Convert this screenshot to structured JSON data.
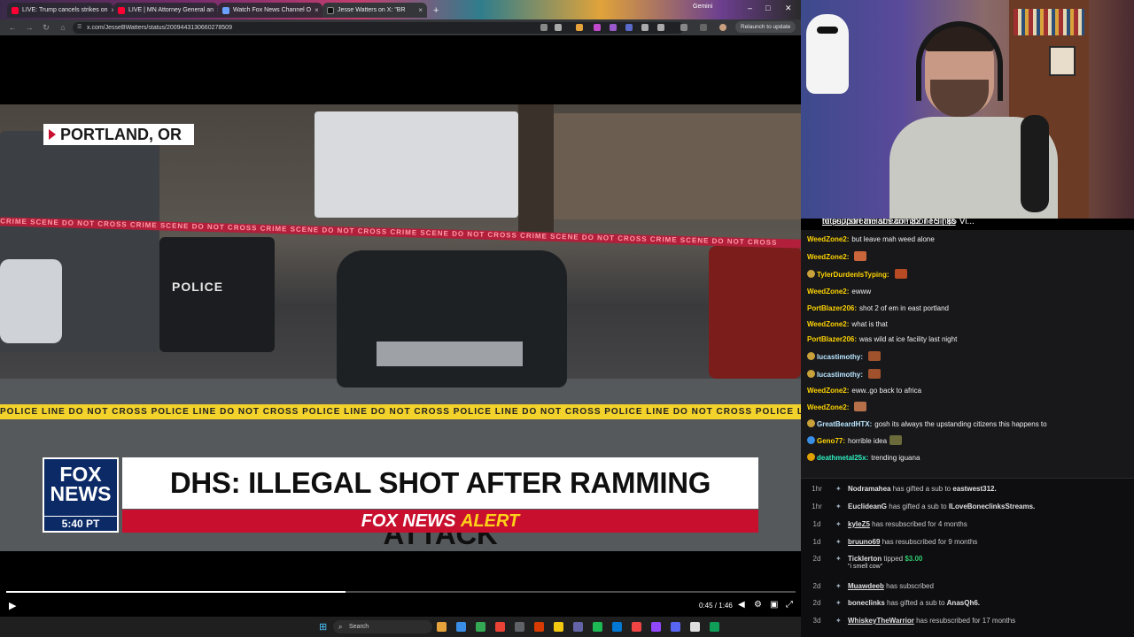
{
  "browser": {
    "tabs": [
      {
        "label": "LIVE: Trump cancels strikes on",
        "color": "#ff0033"
      },
      {
        "label": "LIVE | MN Attorney General an",
        "color": "#ff0033"
      },
      {
        "label": "Watch Fox News Channel O",
        "color": "#6aa0ff"
      },
      {
        "label": "Jesse Watters on X: \"BR",
        "color": "#111111"
      }
    ],
    "new_tab": "+",
    "profile_label": "Gemini",
    "url": "x.com/JesseBWatters/status/2009443130660278509",
    "relaunch_label": "Relaunch to update",
    "window_controls": [
      "–",
      "□",
      "✕"
    ]
  },
  "video": {
    "location": "PORTLAND, OR",
    "police_text": "POLICE",
    "crime_tape_text": "CRIME SCENE DO NOT CROSS   CRIME SCENE DO NOT CROSS   CRIME SCENE DO NOT CROSS   CRIME SCENE DO NOT CROSS   CRIME SCENE DO NOT CROSS   CRIME SCENE DO NOT CROSS",
    "police_tape_text": "POLICE LINE DO NOT CROSS   POLICE LINE DO NOT CROSS   POLICE LINE DO NOT CROSS   POLICE LINE DO NOT CROSS   POLICE LINE DO NOT CROSS   POLICE LINE DO NOT CROSS",
    "network_logo": "FOX NEWS",
    "timestamp": "5:40 PT",
    "headline": "DHS: ILLEGAL SHOT AFTER RAMMING ATTACK",
    "alert_prefix": "FOX NEWS",
    "alert_word": "ALERT",
    "progress": 0.43,
    "time_display": "0:45 / 1:46",
    "play_icon": "▶"
  },
  "taskbar": {
    "search_label": "Search",
    "icons": [
      "#e7a33b",
      "#3a8ee6",
      "#34a853",
      "#ea4335",
      "#5f6368",
      "#d83b01",
      "#f2c811",
      "#6264a7",
      "#1db954",
      "#0078d4",
      "#e44",
      "#9146ff",
      "#5865f2",
      "#ddd",
      "#0f9d58"
    ]
  },
  "chat": {
    "ticker_link": "https://streamlabs.com/boneclinks",
    "ticker_text": " to support the stream! $2 TTS | $5 Vi...",
    "messages": [
      {
        "user": "WeedZone2:",
        "color": "#ffd400",
        "text": "but leave mah weed alone",
        "badge": ""
      },
      {
        "user": "WeedZone2:",
        "color": "#ffd400",
        "text": "",
        "badge": "",
        "emote": "#c9653a"
      },
      {
        "user": "TylerDurdenIsTyping:",
        "color": "#ffd400",
        "text": "",
        "badge": "#c9a13a",
        "emote": "#b84a24"
      },
      {
        "user": "WeedZone2:",
        "color": "#ffd400",
        "text": "ewww",
        "badge": ""
      },
      {
        "user": "PortBlazer206:",
        "color": "#ffd400",
        "text": "shot 2 of em in east portland",
        "badge": ""
      },
      {
        "user": "WeedZone2:",
        "color": "#ffd400",
        "text": "what is that",
        "badge": ""
      },
      {
        "user": "PortBlazer206:",
        "color": "#ffd400",
        "text": "was wild at ice facility last night",
        "badge": ""
      },
      {
        "user": "lucastimothy:",
        "color": "#b9e6ff",
        "text": "",
        "badge": "#c9a13a",
        "emote": "#a0522d"
      },
      {
        "user": "lucastimothy:",
        "color": "#b9e6ff",
        "text": "",
        "badge": "#c9a13a",
        "emote": "#a0522d"
      },
      {
        "user": "WeedZone2:",
        "color": "#ffd400",
        "text": "eww..go back to africa",
        "badge": ""
      },
      {
        "user": "WeedZone2:",
        "color": "#ffd400",
        "text": "",
        "badge": "",
        "emote": "#b5704a"
      },
      {
        "user": "GreatBeardHTX:",
        "color": "#b9e6ff",
        "text": "gosh its always the upstanding citizens this happens to",
        "badge": "#c9a13a"
      },
      {
        "user": "Geno77:",
        "color": "#ffd400",
        "text": "horrible idea",
        "badge": "#3a8ee6",
        "emote": "#6a6a3a"
      },
      {
        "user": "deathmetal25x:",
        "color": "#2ef0c0",
        "text": "trending iguana",
        "badge": "#e0a000"
      }
    ]
  },
  "feed": {
    "events": [
      {
        "time": "1hr",
        "name": "Nodramahea",
        "text": "has gifted a sub to",
        "target": "eastwest312."
      },
      {
        "time": "1hr",
        "name": "EuclideanG",
        "text": "has gifted a sub to",
        "target": "ILoveBoneclinksStreams."
      },
      {
        "time": "1d",
        "name": "kyleZ5",
        "text": "has resubscribed for 4 months",
        "target": ""
      },
      {
        "time": "1d",
        "name": "bruuno69",
        "text": "has resubscribed for 9 months",
        "target": ""
      },
      {
        "time": "2d",
        "name": "Ticklerton",
        "text": "tipped",
        "target": "$3.00",
        "sub": "\"i smell cow\""
      },
      {
        "time": "2d",
        "name": "Muawdeeb",
        "text": "has subscribed",
        "target": ""
      },
      {
        "time": "2d",
        "name": "boneclinks",
        "text": "has gifted a sub to",
        "target": "AnasQh6."
      },
      {
        "time": "3d",
        "name": "WhiskeyTheWarrior",
        "text": "has resubscribed for 17 months",
        "target": ""
      }
    ]
  }
}
